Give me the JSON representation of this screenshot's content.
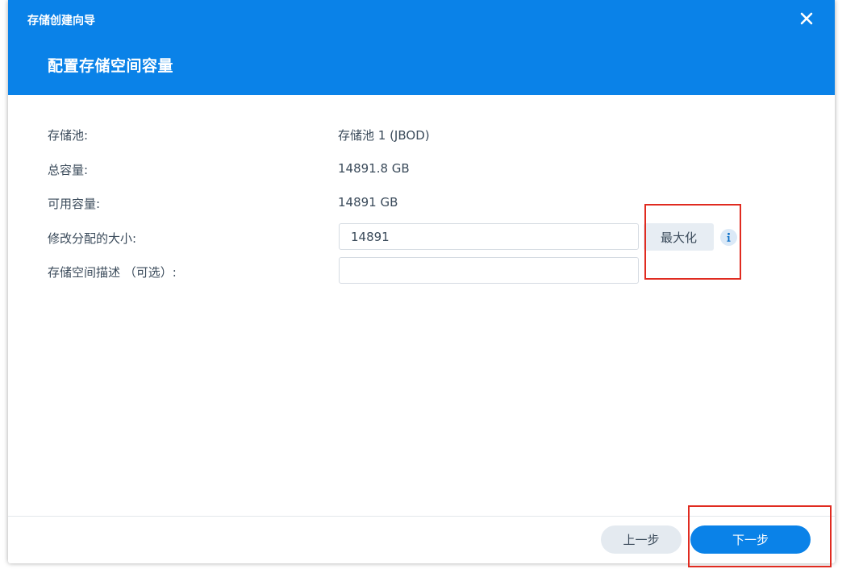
{
  "window": {
    "title": "存储创建向导",
    "close_icon": "close-icon"
  },
  "header": {
    "step_title": "配置存储空间容量"
  },
  "form": {
    "storage_pool": {
      "label": "存储池:",
      "value": "存储池 1 (JBOD)"
    },
    "total_capacity": {
      "label": "总容量:",
      "value": "14891.8 GB"
    },
    "available_capacity": {
      "label": "可用容量:",
      "value": "14891 GB"
    },
    "allocated_size": {
      "label": "修改分配的大小:",
      "value": "14891",
      "max_button": "最大化",
      "info_icon": "info-icon"
    },
    "description": {
      "label": "存储空间描述 （可选）:",
      "value": "",
      "placeholder": ""
    }
  },
  "footer": {
    "prev_label": "上一步",
    "next_label": "下一步"
  },
  "colors": {
    "accent": "#0a82e8",
    "highlight": "#e02b20"
  }
}
